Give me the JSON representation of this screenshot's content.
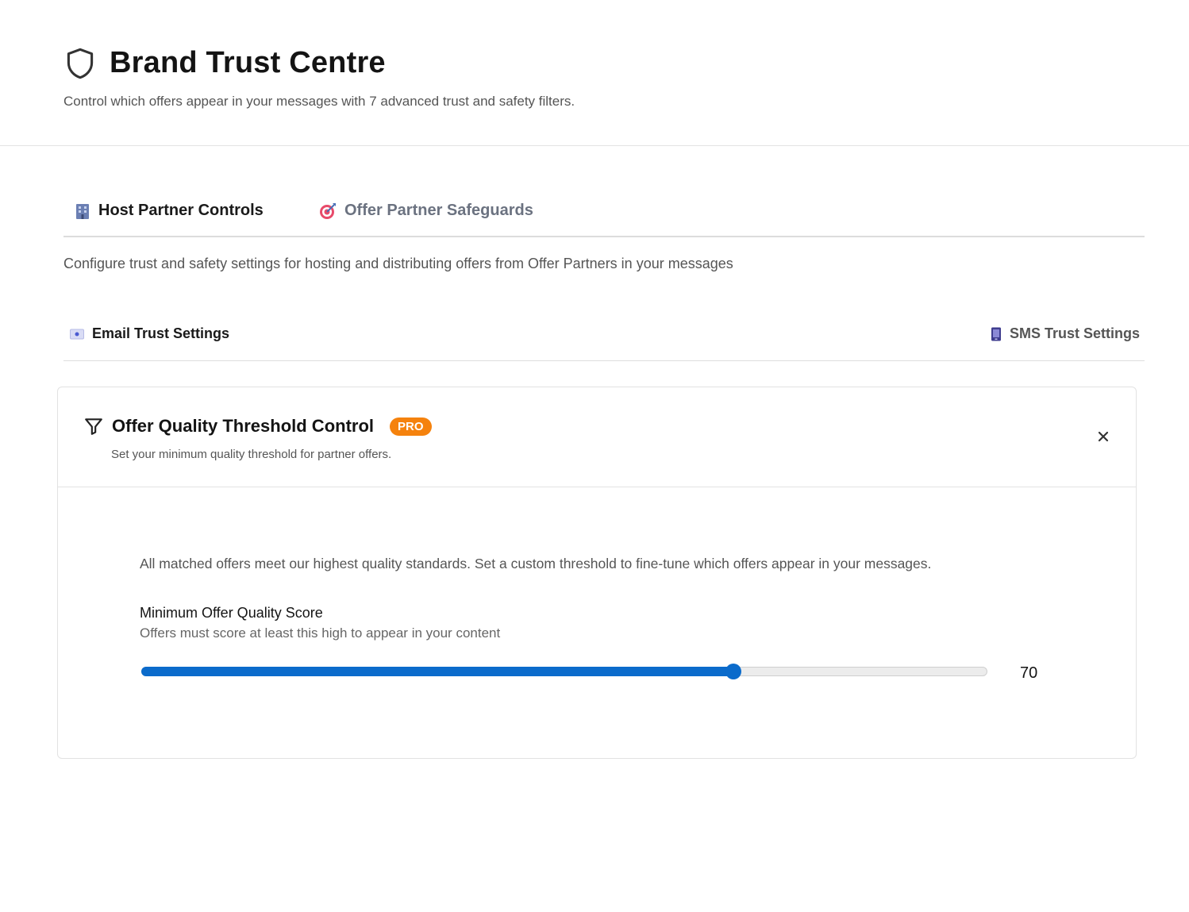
{
  "header": {
    "title": "Brand Trust Centre",
    "subtitle": "Control which offers appear in your messages with 7 advanced trust and safety filters.",
    "icon": "shield-icon"
  },
  "tabs": [
    {
      "label": "Host Partner Controls",
      "icon": "office-building-icon",
      "active": true
    },
    {
      "label": "Offer Partner Safeguards",
      "icon": "target-icon",
      "active": false
    }
  ],
  "tab_description": "Configure trust and safety settings for hosting and distributing offers from Offer Partners in your messages",
  "subtabs": [
    {
      "label": "Email Trust Settings",
      "icon": "email-icon",
      "active": true
    },
    {
      "label": "SMS Trust Settings",
      "icon": "phone-icon",
      "active": false
    }
  ],
  "card": {
    "title": "Offer Quality Threshold Control",
    "badge": "PRO",
    "subtitle": "Set your minimum quality threshold for partner offers.",
    "close_icon": "close-icon",
    "info": "All matched offers meet our highest quality standards. Set a custom threshold to fine-tune which offers appear in your messages.",
    "score_label": "Minimum Offer Quality Score",
    "score_help": "Offers must score at least this high to appear in your content",
    "slider": {
      "value": 70,
      "display": "70",
      "min": 0,
      "max": 100
    }
  },
  "colors": {
    "accent": "#0b6bcb",
    "badge": "#f5820d",
    "muted_text": "#555555"
  }
}
